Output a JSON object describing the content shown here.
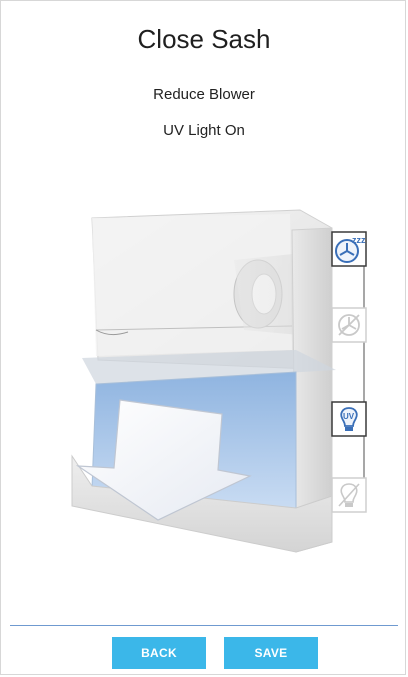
{
  "screen": {
    "title": "Close Sash",
    "line1": "Reduce Blower",
    "line2": "UV Light On"
  },
  "icons": [
    {
      "name": "fan-sleep-icon",
      "active": true,
      "label": "zzz"
    },
    {
      "name": "fan-off-icon",
      "active": false
    },
    {
      "name": "uv-light-icon",
      "active": true,
      "label": "UV"
    },
    {
      "name": "light-off-icon",
      "active": false
    }
  ],
  "buttons": {
    "back": "BACK",
    "save": "SAVE"
  },
  "colors": {
    "accent": "#3bb7e9",
    "divider": "#6f9ad0",
    "icon_active": "#3a6fb8"
  }
}
